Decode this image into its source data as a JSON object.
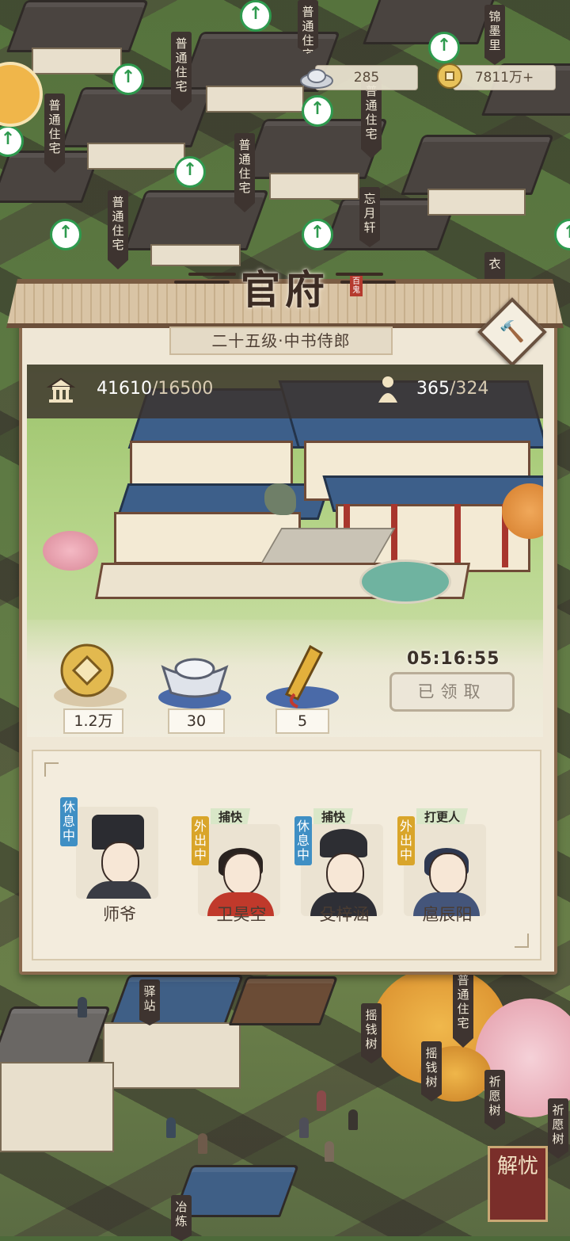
{
  "town": {
    "labels": [
      "普通住宅",
      "普通住宅",
      "普通住宅",
      "普通住宅",
      "普通住宅",
      "普通住宅",
      "锦墨里",
      "忘月轩",
      "衣",
      "驿站",
      "摇钱树",
      "摇钱树",
      "普通住宅",
      "祈愿树",
      "祈愿树",
      "冶炼"
    ],
    "upgrade_glyph": "↑"
  },
  "resources": {
    "silver": "285",
    "coins": "7811万+"
  },
  "panel": {
    "title": "官府",
    "seal": "百鬼",
    "level": "二十五级·中书侍郎",
    "hammer_glyph": "🔨",
    "prosperity": {
      "value": "41610",
      "cap": "/16500"
    },
    "population": {
      "value": "365",
      "cap": "/324"
    },
    "rewards": [
      {
        "name": "coin",
        "value": "1.2万"
      },
      {
        "name": "silver",
        "value": "30"
      },
      {
        "name": "token",
        "value": "5"
      }
    ],
    "timer": "05:16:55",
    "claim_label": "已领取",
    "staff": [
      {
        "name": "师爷",
        "status": "休息中",
        "role": ""
      },
      {
        "name": "卫昊空",
        "status": "外出中",
        "role": "捕快"
      },
      {
        "name": "殳梓涵",
        "status": "休息中",
        "role": "捕快"
      },
      {
        "name": "扈辰阳",
        "status": "外出中",
        "role": "打更人"
      }
    ]
  },
  "corner_button": "解忧",
  "colors": {
    "rest": "#3f8fc4",
    "out": "#d9a52a",
    "accent": "#8a6a4e"
  }
}
